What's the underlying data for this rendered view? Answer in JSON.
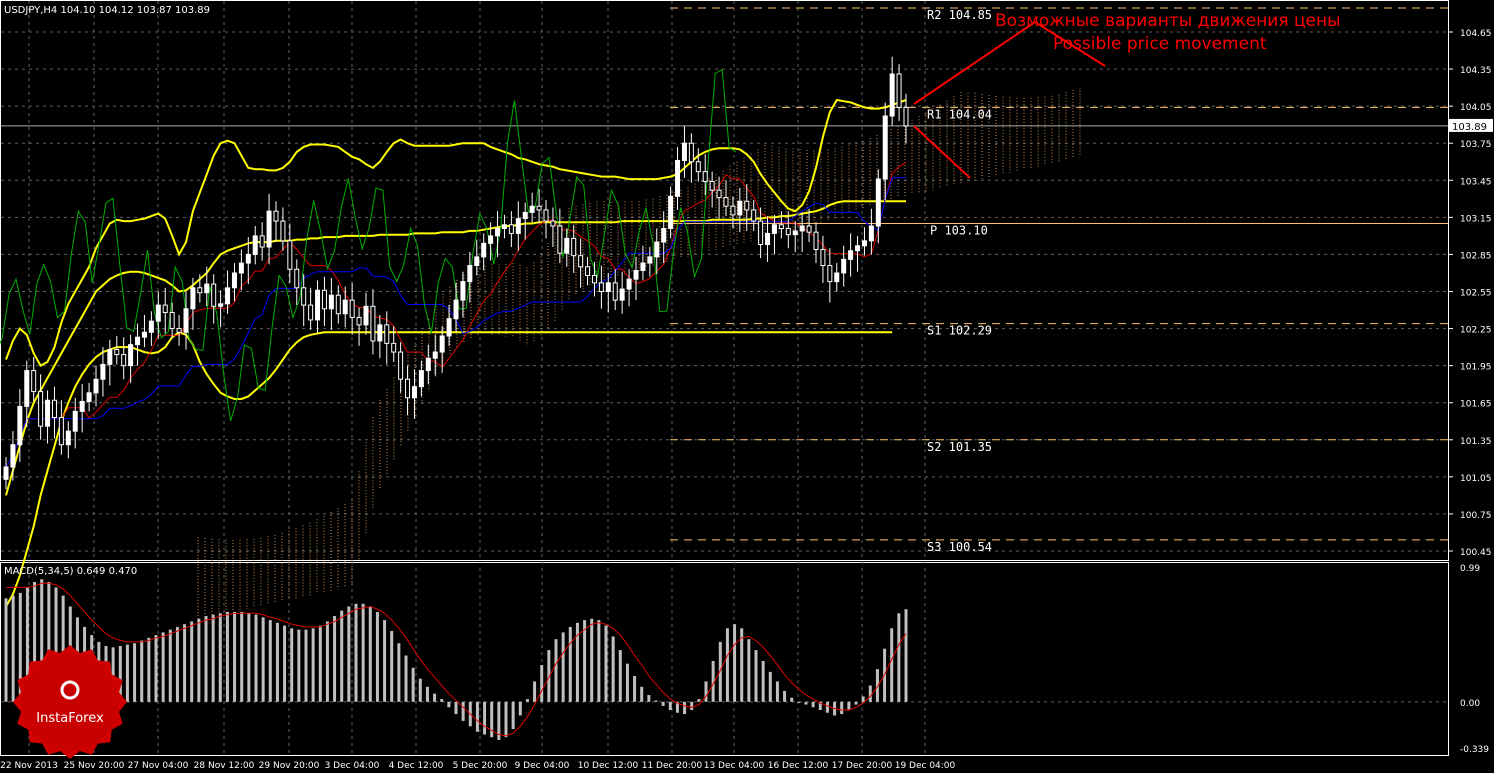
{
  "header": {
    "text": "USDJPY,H4  104.10 104.12 103.87 103.89"
  },
  "annotation": {
    "line1": "Возможные варианты движения цены",
    "line2": "Possible price movement"
  },
  "logo": {
    "text": "InstaForex"
  },
  "colors": {
    "background": "#000000",
    "grid": "#606060",
    "axis": "#ffffff",
    "bull": "#ffffff",
    "bear": "#ffffff",
    "bollinger": "#ffff00",
    "tenkan": "#e00000",
    "kijun": "#0000ff",
    "chikou": "#00b000",
    "cloud": "#c8915a",
    "pivot": "#ffc06a",
    "annotation": "#ff0000",
    "macd_hist": "#c0c0c0",
    "macd_signal": "#e00000"
  },
  "chart_data": [
    {
      "type": "candlestick",
      "symbol": "USDJPY",
      "timeframe": "H4",
      "ohlc_last": {
        "open": 104.1,
        "high": 104.12,
        "low": 103.87,
        "close": 103.89
      },
      "current_price": "103.89",
      "ylim": [
        100.4,
        104.65
      ],
      "y_ticks": [
        "104.65",
        "104.35",
        "104.05",
        "103.75",
        "103.45",
        "103.15",
        "102.85",
        "102.55",
        "102.25",
        "101.95",
        "101.65",
        "101.35",
        "101.05",
        "100.75",
        "100.45"
      ],
      "x_ticks": [
        "22 Nov 2013",
        "25 Nov 20:00",
        "27 Nov 04:00",
        "28 Nov 12:00",
        "29 Nov 20:00",
        "3 Dec 04:00",
        "4 Dec 12:00",
        "5 Dec 20:00",
        "9 Dec 04:00",
        "10 Dec 12:00",
        "11 Dec 20:00",
        "13 Dec 04:00",
        "16 Dec 12:00",
        "17 Dec 20:00",
        "19 Dec 04:00"
      ],
      "pivot_levels": [
        {
          "name": "R2",
          "value": 104.85,
          "label": "R2  104.85"
        },
        {
          "name": "R1",
          "value": 104.04,
          "label": "R1  104.04"
        },
        {
          "name": "P",
          "value": 103.1,
          "label": "P  103.10"
        },
        {
          "name": "S1",
          "value": 102.29,
          "label": "S1  102.29"
        },
        {
          "name": "S2",
          "value": 101.35,
          "label": "S2  101.35"
        },
        {
          "name": "S3",
          "value": 100.54,
          "label": "S3  100.54"
        }
      ],
      "close_series": [
        101.13,
        101.31,
        101.62,
        101.91,
        101.74,
        101.46,
        101.67,
        101.53,
        101.31,
        101.42,
        101.58,
        101.66,
        101.73,
        101.84,
        101.96,
        102.08,
        102.04,
        101.95,
        102.12,
        102.18,
        102.22,
        102.31,
        102.44,
        102.38,
        102.25,
        102.22,
        102.41,
        102.58,
        102.54,
        102.61,
        102.43,
        102.45,
        102.58,
        102.7,
        102.78,
        102.85,
        103.0,
        102.91,
        103.2,
        103.12,
        102.96,
        102.73,
        102.58,
        102.44,
        102.32,
        102.56,
        102.41,
        102.52,
        102.37,
        102.48,
        102.34,
        102.28,
        102.43,
        102.15,
        102.28,
        102.13,
        102.06,
        101.84,
        101.69,
        101.78,
        101.91,
        102.01,
        102.06,
        102.19,
        102.33,
        102.48,
        102.63,
        102.76,
        102.83,
        102.94,
        103.0,
        103.06,
        103.09,
        103.02,
        103.14,
        103.19,
        103.24,
        103.21,
        103.12,
        103.08,
        102.86,
        102.98,
        102.84,
        102.75,
        102.68,
        102.62,
        102.55,
        102.62,
        102.48,
        102.57,
        102.65,
        102.72,
        102.78,
        102.83,
        102.95,
        103.06,
        103.32,
        103.61,
        103.75,
        103.6,
        103.52,
        103.44,
        103.37,
        103.31,
        103.24,
        103.17,
        103.28,
        103.21,
        103.12,
        102.93,
        103.02,
        103.09,
        103.06,
        103.01,
        103.04,
        103.08,
        103.03,
        102.89,
        102.76,
        102.63,
        102.7,
        102.81,
        102.88,
        102.92,
        102.96,
        103.08,
        103.46,
        103.97,
        104.31,
        104.04,
        103.89
      ],
      "bollinger_upper": [
        102.0,
        102.15,
        102.25,
        102.2,
        102.05,
        101.95,
        101.98,
        102.1,
        102.3,
        102.45,
        102.55,
        102.65,
        102.75,
        102.9,
        103.0,
        103.1,
        103.13,
        103.12,
        103.12,
        103.13,
        103.14,
        103.16,
        103.18,
        103.14,
        103.0,
        102.85,
        102.95,
        103.2,
        103.35,
        103.5,
        103.65,
        103.75,
        103.77,
        103.75,
        103.65,
        103.55,
        103.54,
        103.54,
        103.53,
        103.53,
        103.55,
        103.6,
        103.68,
        103.72,
        103.74,
        103.74,
        103.74,
        103.73,
        103.72,
        103.68,
        103.64,
        103.62,
        103.58,
        103.55,
        103.6,
        103.68,
        103.75,
        103.78,
        103.75,
        103.73,
        103.73,
        103.73,
        103.73,
        103.73,
        103.73,
        103.74,
        103.75,
        103.75,
        103.75,
        103.75,
        103.72,
        103.7,
        103.68,
        103.66,
        103.63,
        103.62,
        103.6,
        103.58,
        103.57,
        103.56,
        103.54,
        103.53,
        103.52,
        103.51,
        103.5,
        103.49,
        103.48,
        103.48,
        103.48,
        103.47,
        103.46,
        103.46,
        103.46,
        103.46,
        103.46,
        103.47,
        103.48,
        103.5,
        103.55,
        103.6,
        103.65,
        103.68,
        103.7,
        103.71,
        103.71,
        103.71,
        103.7,
        103.66,
        103.6,
        103.5,
        103.42,
        103.35,
        103.28,
        103.22,
        103.2,
        103.25,
        103.36,
        103.55,
        103.8,
        104.0,
        104.1,
        104.09,
        104.08,
        104.06,
        104.04,
        104.03,
        104.03,
        104.04,
        104.06,
        104.08,
        104.1
      ],
      "bollinger_middle": [
        100.9,
        101.1,
        101.3,
        101.5,
        101.65,
        101.75,
        101.85,
        101.95,
        102.05,
        102.15,
        102.25,
        102.35,
        102.45,
        102.55,
        102.6,
        102.65,
        102.68,
        102.7,
        102.71,
        102.71,
        102.7,
        102.68,
        102.66,
        102.64,
        102.6,
        102.55,
        102.56,
        102.6,
        102.65,
        102.7,
        102.78,
        102.85,
        102.88,
        102.9,
        102.92,
        102.94,
        102.95,
        102.95,
        102.95,
        102.96,
        102.96,
        102.96,
        102.97,
        102.97,
        102.98,
        102.98,
        102.99,
        102.99,
        102.99,
        103.0,
        103.0,
        103.0,
        103.0,
        103.0,
        103.01,
        103.01,
        103.01,
        103.01,
        103.01,
        103.02,
        103.02,
        103.02,
        103.02,
        103.03,
        103.03,
        103.03,
        103.03,
        103.04,
        103.04,
        103.05,
        103.06,
        103.07,
        103.08,
        103.08,
        103.09,
        103.1,
        103.1,
        103.11,
        103.11,
        103.11,
        103.11,
        103.11,
        103.11,
        103.11,
        103.11,
        103.11,
        103.11,
        103.11,
        103.11,
        103.12,
        103.12,
        103.12,
        103.12,
        103.12,
        103.12,
        103.12,
        103.12,
        103.12,
        103.12,
        103.12,
        103.12,
        103.12,
        103.13,
        103.13,
        103.13,
        103.13,
        103.13,
        103.13,
        103.14,
        103.14,
        103.15,
        103.15,
        103.16,
        103.16,
        103.17,
        103.18,
        103.19,
        103.2,
        103.22,
        103.25,
        103.27,
        103.28,
        103.28,
        103.28,
        103.28,
        103.28,
        103.28,
        103.28,
        103.28,
        103.28,
        103.28
      ],
      "bollinger_lower": [
        100.0,
        100.1,
        100.25,
        100.45,
        100.65,
        100.9,
        101.1,
        101.3,
        101.5,
        101.65,
        101.78,
        101.88,
        101.96,
        102.02,
        102.06,
        102.08,
        102.1,
        102.1,
        102.1,
        102.08,
        102.06,
        102.05,
        102.06,
        102.1,
        102.18,
        102.22,
        102.2,
        102.12,
        101.98,
        101.88,
        101.8,
        101.73,
        101.7,
        101.68,
        101.68,
        101.7,
        101.75,
        101.8,
        101.85,
        101.92,
        102.0,
        102.08,
        102.14,
        102.18,
        102.2,
        102.21,
        102.22,
        102.22,
        102.22,
        102.22,
        102.22,
        102.22,
        102.22,
        102.22,
        102.22,
        102.22,
        102.22,
        102.22,
        102.22,
        102.22,
        102.22,
        102.22,
        102.22,
        102.22,
        102.22,
        102.22,
        102.22,
        102.22,
        102.22,
        102.22,
        102.22,
        102.22,
        102.22,
        102.22,
        102.22,
        102.22,
        102.22,
        102.22,
        102.22,
        102.22,
        102.22,
        102.22,
        102.22,
        102.22,
        102.22,
        102.22,
        102.22,
        102.22,
        102.22,
        102.22,
        102.22,
        102.22,
        102.22,
        102.22,
        102.22,
        102.22,
        102.22,
        102.22,
        102.22,
        102.22,
        102.22,
        102.22,
        102.22,
        102.22,
        102.22,
        102.22,
        102.22,
        102.22,
        102.22,
        102.22,
        102.22,
        102.22,
        102.22,
        102.22,
        102.22,
        102.22,
        102.22,
        102.22,
        102.22,
        102.22,
        102.22,
        102.22,
        102.22,
        102.22,
        102.22,
        102.22,
        102.22,
        102.22,
        102.22
      ]
    },
    {
      "type": "macd",
      "label": "MACD(5,34,5) 0.649 0.470",
      "y_ticks": [
        "0.99",
        "0.00",
        "-0.339"
      ],
      "ylim": [
        -0.339,
        0.99
      ],
      "histogram": [
        0.76,
        0.78,
        0.8,
        0.84,
        0.88,
        0.9,
        0.88,
        0.84,
        0.78,
        0.7,
        0.62,
        0.55,
        0.49,
        0.44,
        0.41,
        0.4,
        0.41,
        0.42,
        0.43,
        0.45,
        0.47,
        0.49,
        0.51,
        0.53,
        0.55,
        0.57,
        0.59,
        0.61,
        0.63,
        0.64,
        0.65,
        0.66,
        0.66,
        0.66,
        0.65,
        0.64,
        0.62,
        0.6,
        0.58,
        0.56,
        0.54,
        0.53,
        0.53,
        0.54,
        0.56,
        0.59,
        0.63,
        0.67,
        0.7,
        0.72,
        0.72,
        0.7,
        0.66,
        0.6,
        0.52,
        0.43,
        0.34,
        0.25,
        0.17,
        0.11,
        0.06,
        0.02,
        -0.04,
        -0.09,
        -0.14,
        -0.18,
        -0.22,
        -0.24,
        -0.26,
        -0.28,
        -0.26,
        -0.2,
        -0.1,
        0.02,
        0.15,
        0.27,
        0.38,
        0.46,
        0.51,
        0.55,
        0.58,
        0.6,
        0.61,
        0.6,
        0.56,
        0.48,
        0.38,
        0.28,
        0.19,
        0.11,
        0.05,
        0.01,
        -0.03,
        -0.06,
        -0.08,
        -0.09,
        -0.06,
        0.02,
        0.15,
        0.3,
        0.44,
        0.54,
        0.57,
        0.54,
        0.46,
        0.38,
        0.3,
        0.22,
        0.15,
        0.08,
        0.03,
        0.0,
        -0.02,
        -0.04,
        -0.06,
        -0.08,
        -0.1,
        -0.09,
        -0.06,
        -0.02,
        0.04,
        0.12,
        0.24,
        0.39,
        0.54,
        0.65,
        0.68
      ],
      "signal": [
        0.84,
        0.84,
        0.84,
        0.84,
        0.85,
        0.87,
        0.87,
        0.86,
        0.83,
        0.78,
        0.72,
        0.66,
        0.6,
        0.55,
        0.5,
        0.47,
        0.45,
        0.44,
        0.44,
        0.44,
        0.45,
        0.47,
        0.48,
        0.5,
        0.52,
        0.54,
        0.56,
        0.58,
        0.6,
        0.61,
        0.63,
        0.64,
        0.65,
        0.65,
        0.65,
        0.65,
        0.64,
        0.62,
        0.61,
        0.59,
        0.57,
        0.56,
        0.55,
        0.55,
        0.55,
        0.57,
        0.59,
        0.62,
        0.65,
        0.68,
        0.69,
        0.7,
        0.68,
        0.65,
        0.6,
        0.54,
        0.47,
        0.39,
        0.31,
        0.24,
        0.18,
        0.12,
        0.06,
        0.01,
        -0.04,
        -0.09,
        -0.14,
        -0.18,
        -0.21,
        -0.24,
        -0.25,
        -0.23,
        -0.18,
        -0.11,
        -0.02,
        0.08,
        0.18,
        0.28,
        0.36,
        0.43,
        0.49,
        0.53,
        0.57,
        0.58,
        0.57,
        0.54,
        0.49,
        0.42,
        0.34,
        0.27,
        0.19,
        0.13,
        0.07,
        0.02,
        -0.01,
        -0.03,
        -0.04,
        -0.02,
        0.04,
        0.13,
        0.23,
        0.34,
        0.42,
        0.47,
        0.48,
        0.45,
        0.4,
        0.34,
        0.27,
        0.2,
        0.14,
        0.09,
        0.05,
        0.02,
        -0.01,
        -0.03,
        -0.05,
        -0.06,
        -0.06,
        -0.04,
        -0.01,
        0.04,
        0.11,
        0.2,
        0.31,
        0.42,
        0.5
      ]
    }
  ]
}
